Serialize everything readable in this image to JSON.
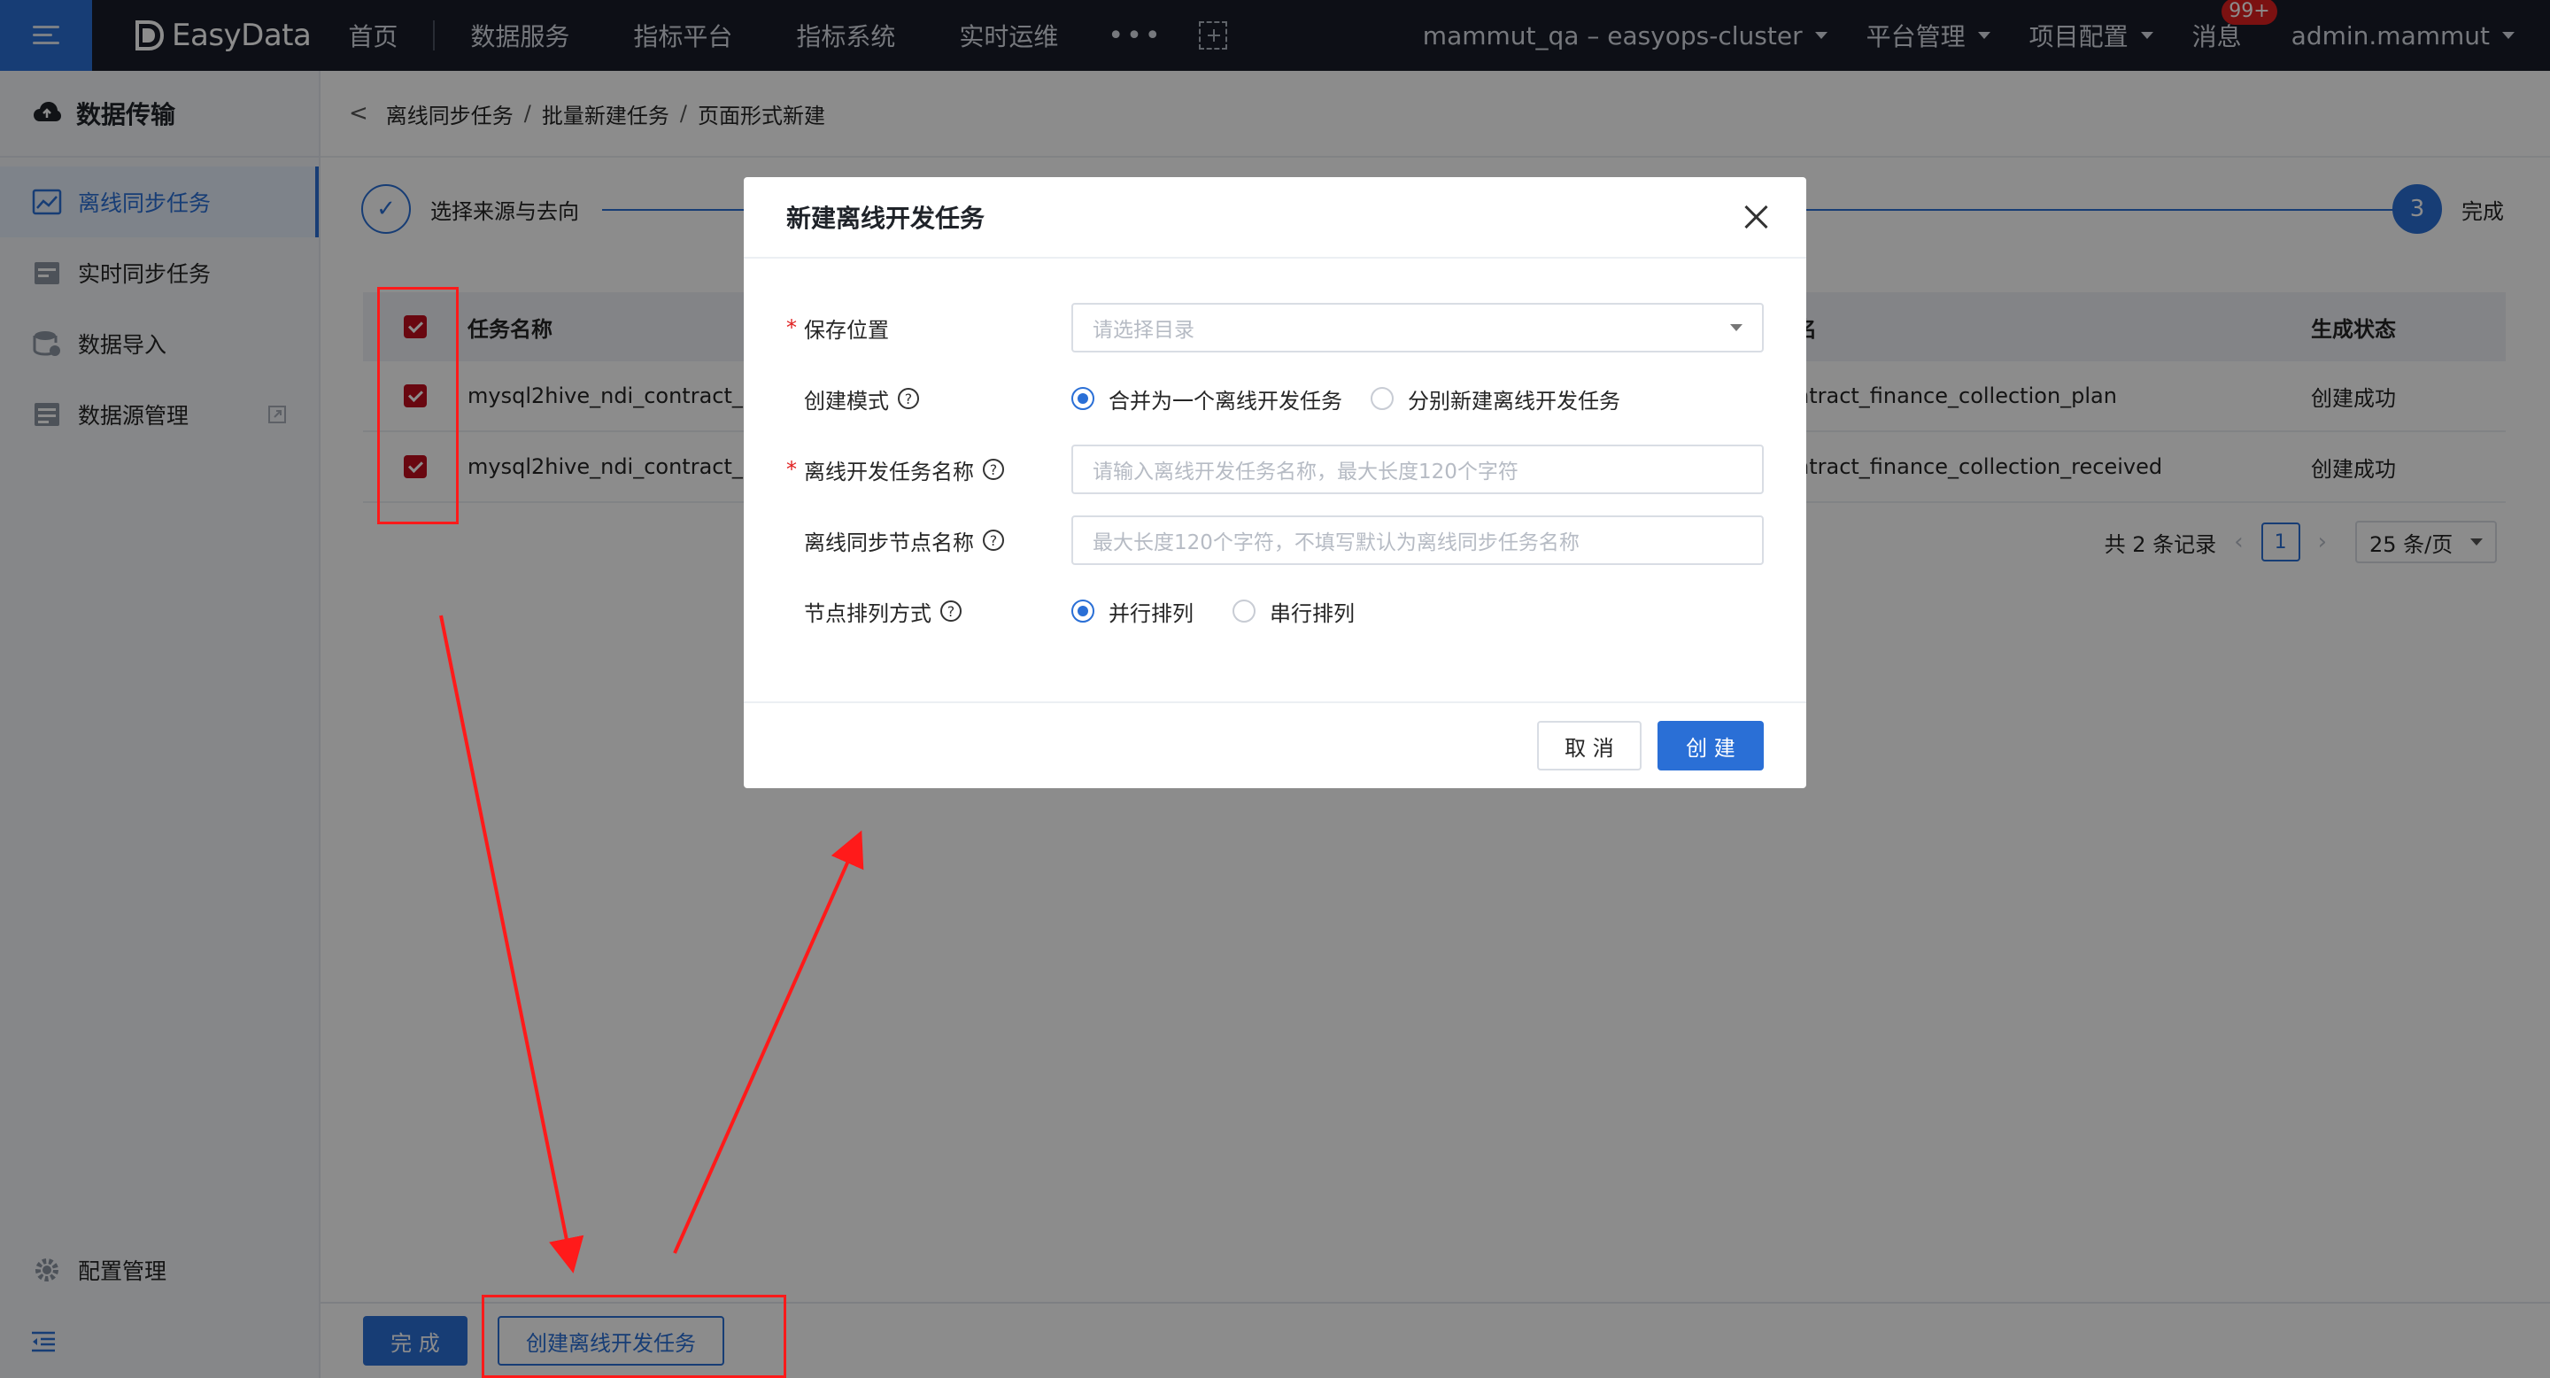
{
  "app": {
    "logo": "EasyData"
  },
  "topnav": {
    "items": [
      "首页",
      "数据服务",
      "指标平台",
      "指标系统",
      "实时运维"
    ],
    "more": "•••",
    "cluster": "mammut_qa – easyops-cluster",
    "platform_admin": "平台管理",
    "project_config": "项目配置",
    "messages": "消息",
    "messages_badge": "99+",
    "user": "admin.mammut"
  },
  "sidebar": {
    "title": "数据传输",
    "items": [
      {
        "label": "离线同步任务",
        "icon": "chart-icon",
        "active": true
      },
      {
        "label": "实时同步任务",
        "icon": "calendar-icon",
        "active": false
      },
      {
        "label": "数据导入",
        "icon": "database-import-icon",
        "active": false
      },
      {
        "label": "数据源管理",
        "icon": "datasource-icon",
        "active": false
      }
    ],
    "bottom": "配置管理"
  },
  "breadcrumb": {
    "parts": [
      "离线同步任务",
      "批量新建任务",
      "页面形式新建"
    ],
    "separator": "/"
  },
  "steps": {
    "step1_label": "选择来源与去向",
    "step3_number": "3",
    "step3_label": "完成"
  },
  "table": {
    "headers": {
      "name": "任务名称",
      "target": "名",
      "status": "生成状态"
    },
    "rows": [
      {
        "name": "mysql2hive_ndi_contract_",
        "target": "ntract_finance_collection_plan",
        "status": "创建成功",
        "checked": true
      },
      {
        "name": "mysql2hive_ndi_contract_",
        "target": "ntract_finance_collection_received",
        "status": "创建成功",
        "checked": true
      }
    ]
  },
  "pagination": {
    "total": "共 2 条记录",
    "page": "1",
    "page_size": "25 条/页"
  },
  "footer": {
    "done_label": "完 成",
    "create_task_label": "创建离线开发任务"
  },
  "modal": {
    "title": "新建离线开发任务",
    "save_location": {
      "label": "保存位置",
      "placeholder": "请选择目录",
      "required": true
    },
    "create_mode": {
      "label": "创建模式",
      "options": [
        "合并为一个离线开发任务",
        "分别新建离线开发任务"
      ],
      "selected": 0
    },
    "task_name": {
      "label": "离线开发任务名称",
      "placeholder": "请输入离线开发任务名称，最大长度120个字符",
      "required": true
    },
    "node_name": {
      "label": "离线同步节点名称",
      "placeholder": "最大长度120个字符，不填写默认为离线同步任务名称"
    },
    "node_order": {
      "label": "节点排列方式",
      "options": [
        "并行排列",
        "串行排列"
      ],
      "selected": 0
    },
    "cancel_label": "取 消",
    "create_label": "创 建"
  },
  "colors": {
    "primary": "#2a6fd6",
    "topbar": "#181d28",
    "annotation": "#ff1a1a",
    "checkbox": "#c00d1e"
  }
}
